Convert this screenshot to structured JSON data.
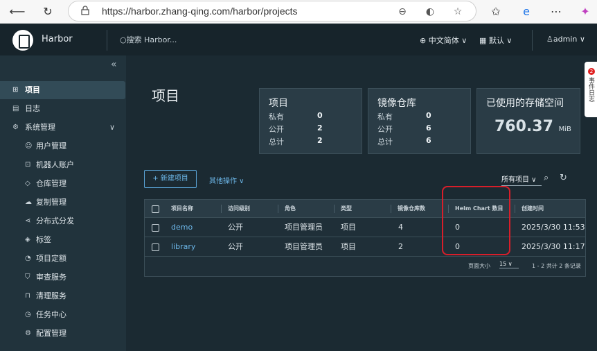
{
  "browser": {
    "url": "https://harbor.zhang-qing.com/harbor/projects"
  },
  "header": {
    "brand": "Harbor",
    "search_placeholder": "搜索 Harbor...",
    "language": "中文简体",
    "theme": "默认",
    "user": "admin"
  },
  "sidebar": {
    "items": [
      {
        "label": "项目",
        "icon": "project-icon",
        "active": true
      },
      {
        "label": "日志",
        "icon": "log-icon"
      },
      {
        "label": "系统管理",
        "icon": "admin-icon"
      }
    ],
    "subitems": [
      {
        "label": "用户管理",
        "icon": "users-icon"
      },
      {
        "label": "机器人账户",
        "icon": "robot-icon"
      },
      {
        "label": "仓库管理",
        "icon": "registry-icon"
      },
      {
        "label": "复制管理",
        "icon": "replication-icon"
      },
      {
        "label": "分布式分发",
        "icon": "distribution-icon"
      },
      {
        "label": "标签",
        "icon": "tag-icon"
      },
      {
        "label": "项目定额",
        "icon": "quota-icon"
      },
      {
        "label": "审查服务",
        "icon": "shield-icon"
      },
      {
        "label": "清理服务",
        "icon": "trash-icon"
      },
      {
        "label": "任务中心",
        "icon": "clock-icon"
      },
      {
        "label": "配置管理",
        "icon": "gear-icon"
      }
    ]
  },
  "main": {
    "title": "项目",
    "cards": {
      "projects": {
        "title": "项目",
        "private_label": "私有",
        "private": "0",
        "public_label": "公开",
        "public": "2",
        "total_label": "总计",
        "total": "2"
      },
      "repos": {
        "title": "镜像仓库",
        "private_label": "私有",
        "private": "0",
        "public_label": "公开",
        "public": "6",
        "total_label": "总计",
        "total": "6"
      },
      "storage": {
        "title": "已使用的存储空间",
        "value": "760.37",
        "unit": "MiB"
      }
    },
    "new_project": "+ 新建项目",
    "other_ops": "其他操作 ∨",
    "filter": "所有项目 ∨",
    "table": {
      "headers": [
        "项目名称",
        "访问级别",
        "角色",
        "类型",
        "镜像仓库数",
        "Helm Chart 数目",
        "创建时间"
      ],
      "rows": [
        [
          "demo",
          "公开",
          "项目管理员",
          "项目",
          "4",
          "0",
          "2025/3/30 11:53"
        ],
        [
          "library",
          "公开",
          "项目管理员",
          "项目",
          "2",
          "0",
          "2025/3/30 11:17"
        ]
      ],
      "page_size_label": "页面大小",
      "page_size": "15",
      "summary": "1 - 2 共计 2 条记录"
    }
  },
  "side_tab": {
    "label": "事件日志",
    "badge": "2"
  }
}
